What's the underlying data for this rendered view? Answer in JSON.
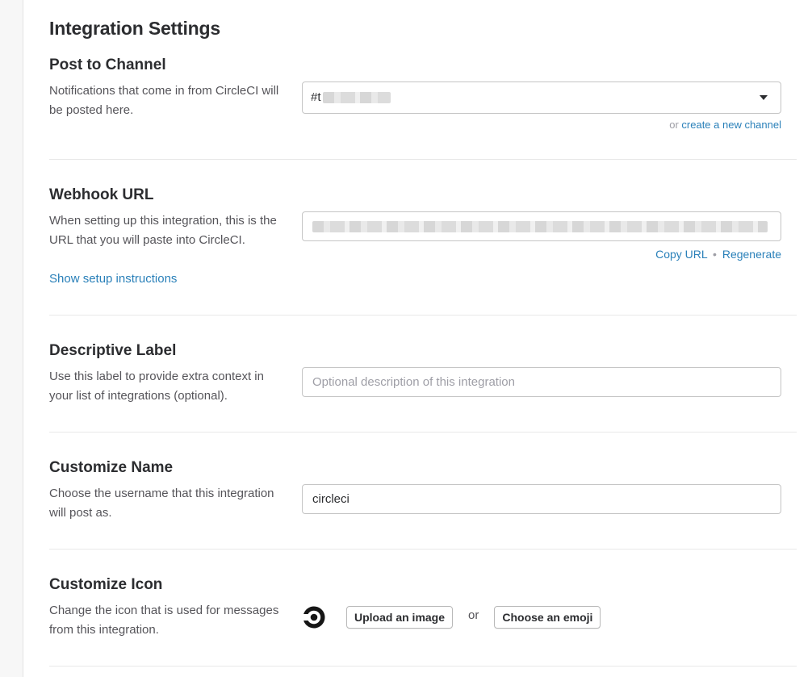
{
  "page": {
    "title": "Integration Settings"
  },
  "post_to_channel": {
    "title": "Post to Channel",
    "description": "Notifications that come in from CircleCI will be posted here.",
    "selected_channel_prefix": "#t",
    "helper_or": "or",
    "create_channel_link": "create a new channel"
  },
  "webhook": {
    "title": "Webhook URL",
    "description": "When setting up this integration, this is the URL that you will paste into CircleCI.",
    "setup_link": "Show setup instructions",
    "copy_link": "Copy URL",
    "separator": "•",
    "regenerate_link": "Regenerate"
  },
  "descriptive_label": {
    "title": "Descriptive Label",
    "description": "Use this label to provide extra context in your list of integrations (optional).",
    "placeholder": "Optional description of this integration",
    "value": ""
  },
  "customize_name": {
    "title": "Customize Name",
    "description": "Choose the username that this integration will post as.",
    "value": "circleci"
  },
  "customize_icon": {
    "title": "Customize Icon",
    "description": "Change the icon that is used for messages from this integration.",
    "icon": "circleci-logo-icon",
    "upload_label": "Upload an image",
    "or_text": "or",
    "emoji_label": "Choose an emoji"
  },
  "colors": {
    "link": "#2a80b9",
    "text": "#2c2d30",
    "muted": "#9e9ea6"
  }
}
